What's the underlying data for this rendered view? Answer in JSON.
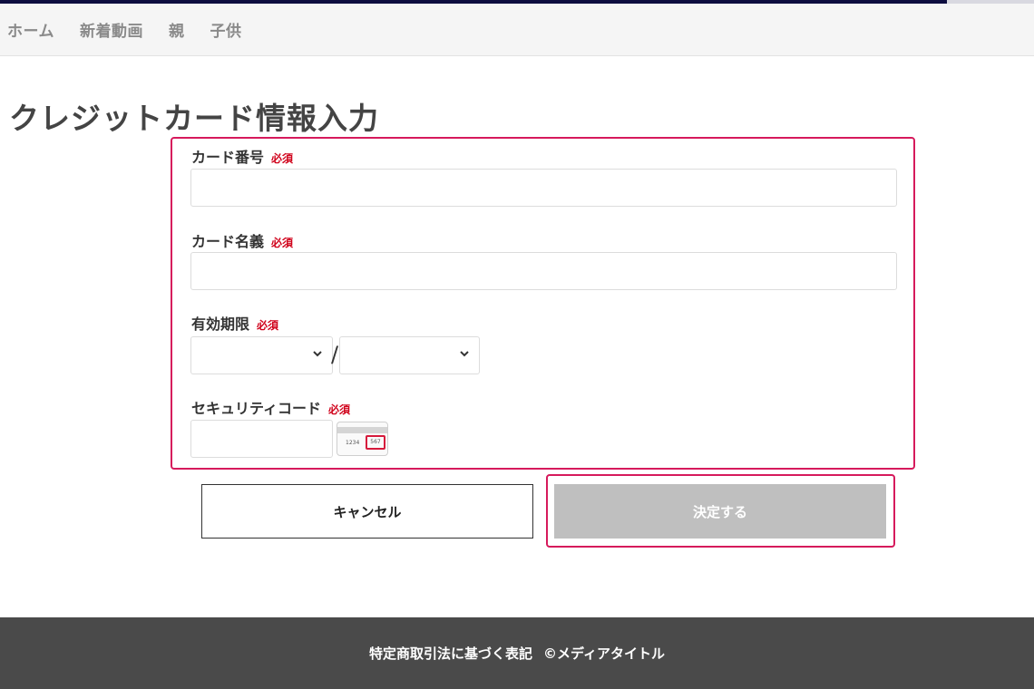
{
  "nav": {
    "items": [
      {
        "label": "ホーム"
      },
      {
        "label": "新着動画"
      },
      {
        "label": "親"
      },
      {
        "label": "子供"
      }
    ]
  },
  "page": {
    "title": "クレジットカード情報入力"
  },
  "form": {
    "required_badge": "必須",
    "card_number": {
      "label": "カード番号",
      "value": ""
    },
    "card_name": {
      "label": "カード名義",
      "value": ""
    },
    "expiry": {
      "label": "有効期限",
      "month_value": "",
      "year_value": "",
      "separator": "/"
    },
    "security_code": {
      "label": "セキュリティコード",
      "value": "",
      "example_digits": "1234",
      "example_code": "567"
    }
  },
  "buttons": {
    "cancel_label": "キャンセル",
    "submit_label": "決定する"
  },
  "footer": {
    "legal_link": "特定商取引法に基づく表記",
    "copyright": "©メディアタイトル"
  },
  "colors": {
    "highlight": "#d61a5c",
    "required": "#d0021b",
    "submit_disabled": "#bfbfbf",
    "footer_bg": "#4a4a4a",
    "top_accent": "#0d0d3f"
  }
}
